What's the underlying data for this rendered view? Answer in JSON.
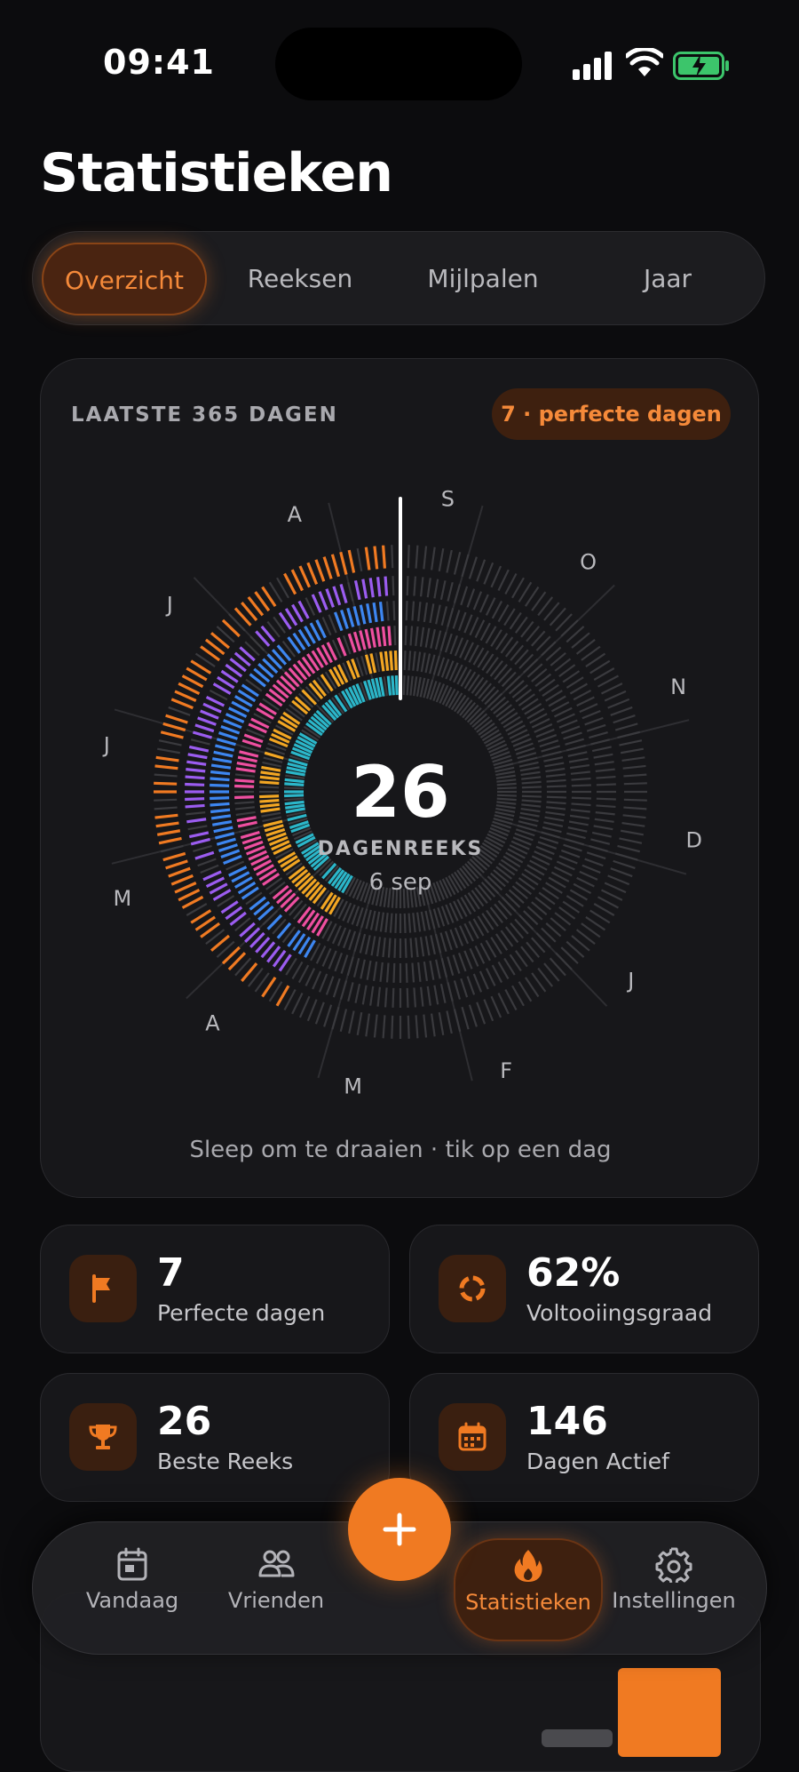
{
  "status_bar": {
    "time": "09:41"
  },
  "page_title": "Statistieken",
  "tabs": [
    {
      "label": "Overzicht",
      "active": true
    },
    {
      "label": "Reeksen",
      "active": false
    },
    {
      "label": "Mijlpalen",
      "active": false
    },
    {
      "label": "Jaar",
      "active": false
    }
  ],
  "overview_card": {
    "label": "LAATSTE 365 DAGEN",
    "badge": "7 · perfecte dagen",
    "streak_value": "26",
    "streak_label": "DAGENREEKS",
    "streak_date": "6 sep",
    "month_labels": [
      "S",
      "O",
      "N",
      "D",
      "J",
      "F",
      "M",
      "A",
      "M",
      "J",
      "J",
      "A"
    ],
    "hint": "Sleep om te draaien · tik op een dag"
  },
  "stats": [
    {
      "value": "7",
      "label": "Perfecte dagen",
      "icon": "flag-icon"
    },
    {
      "value": "62%",
      "label": "Voltooiingsgraad",
      "icon": "ring-icon"
    },
    {
      "value": "26",
      "label": "Beste Reeks",
      "icon": "trophy-icon"
    },
    {
      "value": "146",
      "label": "Dagen Actief",
      "icon": "calendar-icon"
    }
  ],
  "nav": {
    "items": [
      {
        "label": "Vandaag",
        "icon": "calendar-icon"
      },
      {
        "label": "Vrienden",
        "icon": "friends-icon"
      },
      {
        "label": "Statistieken",
        "icon": "flame-icon",
        "active": true
      },
      {
        "label": "Instellingen",
        "icon": "gear-icon"
      }
    ],
    "add_button_icon": "plus-icon"
  },
  "colors": {
    "accent": "#f07a22",
    "ring_purple": "#9b5cf0",
    "ring_blue": "#3d86f0",
    "ring_pink": "#ee4fa0",
    "ring_yellow": "#f2a623",
    "ring_teal": "#2bb6c9",
    "inactive": "#3a3a3e"
  }
}
